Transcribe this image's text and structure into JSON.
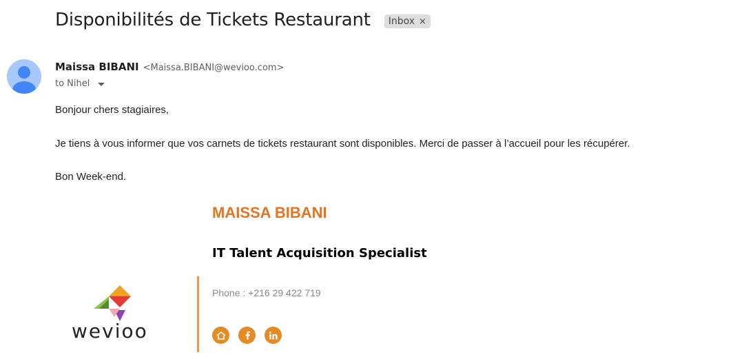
{
  "email": {
    "subject": "Disponibilités de Tickets Restaurant",
    "label_chip": "Inbox",
    "label_close": "×",
    "sender_name": "Maissa BIBANI",
    "sender_email": "<Maissa.BIBANI@wevioo.com>",
    "to_line": "to Nihel",
    "body": [
      "Bonjour chers stagiaires,",
      "Je tiens à vous informer que vos carnets de tickets restaurant sont disponibles. Merci de passer à l’accueil pour les récupérer.",
      "Bon Week-end."
    ]
  },
  "signature": {
    "name": "MAISSA BIBANI",
    "title": "IT Talent Acquisition Specialist",
    "phone": "Phone : +216 29 422 719",
    "logo_text": "wevioo",
    "icons": [
      "home-icon",
      "facebook-icon",
      "linkedin-icon"
    ]
  },
  "colors": {
    "accent_orange": "#e8731f",
    "icon_orange": "#e38b24",
    "divider": "#e29a46",
    "avatar_bg": "#a8c7fa",
    "avatar_fg": "#4285f4"
  }
}
